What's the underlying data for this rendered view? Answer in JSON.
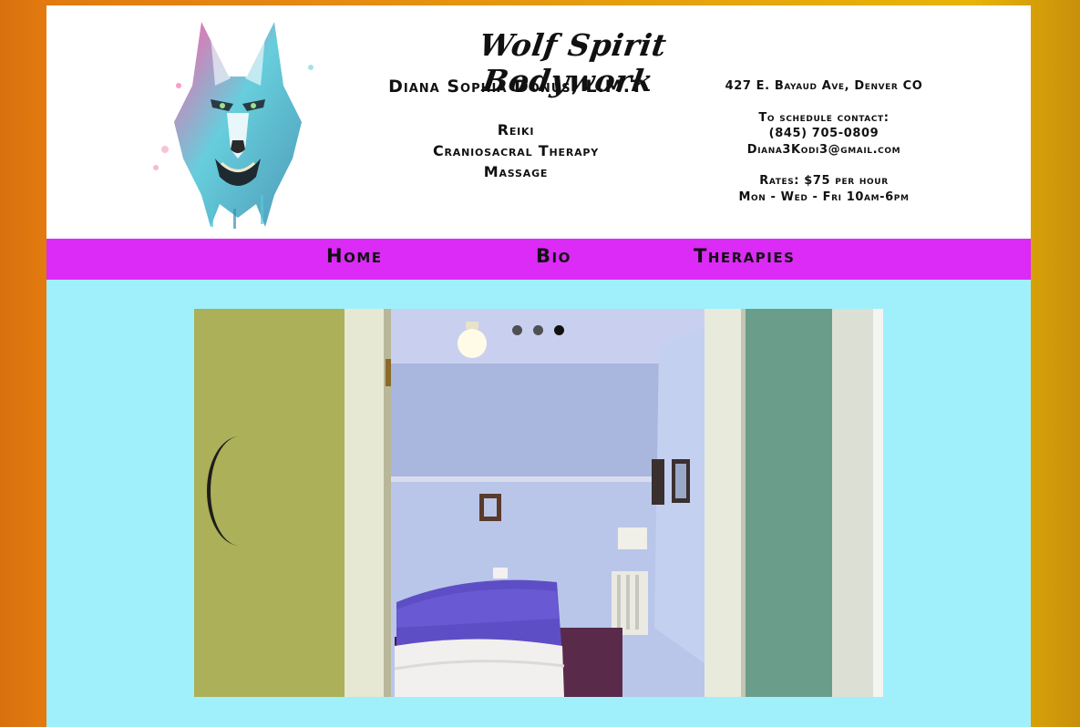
{
  "header": {
    "site_title": "Wolf Spirit Bodywork",
    "owner": "Diana Sophia Donus, L.M.T",
    "services": [
      "Reiki",
      "Craniosacral Therapy",
      "Massage"
    ],
    "address": "427 E. Bayaud Ave, Denver CO",
    "schedule_label": "To schedule contact:",
    "phone": "(845) 705-0809",
    "email": "Diana3Kodi3@gmail.com",
    "rates": "Rates: $75 per hour",
    "hours": "Mon - Wed - Fri 10am-6pm"
  },
  "nav": {
    "items": [
      {
        "label": "Home"
      },
      {
        "label": "Bio"
      },
      {
        "label": "Therapies"
      }
    ]
  },
  "slideshow": {
    "slide_count": 3,
    "active_index": 2
  },
  "colors": {
    "nav_bg": "#dc2af7",
    "content_bg": "#a0f0fb",
    "header_bg": "#ffffff"
  }
}
